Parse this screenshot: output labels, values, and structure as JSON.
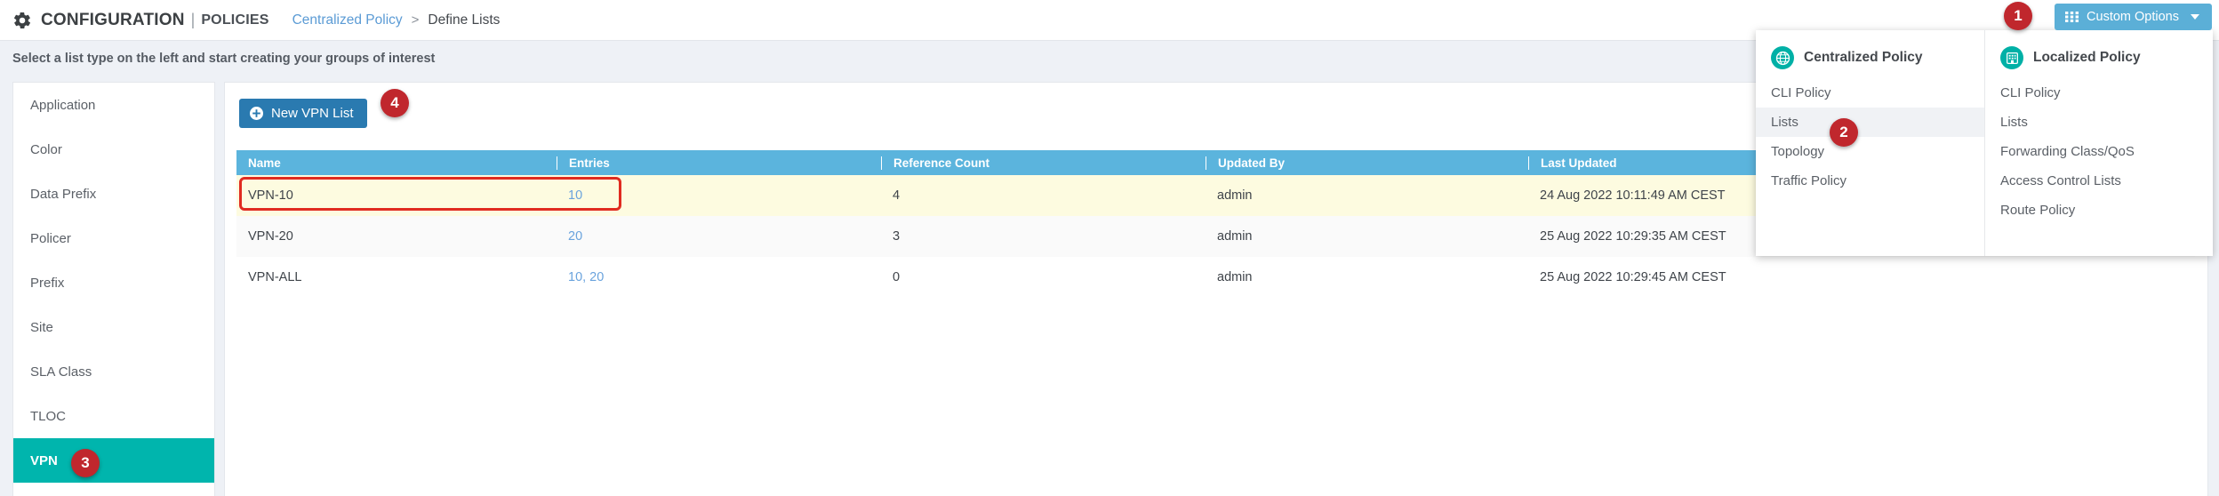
{
  "header": {
    "gear_icon": "gear-icon",
    "app_title": "CONFIGURATION",
    "title_separator": "|",
    "section": "POLICIES",
    "breadcrumb": {
      "link": "Centralized Policy",
      "separator": ">",
      "current": "Define Lists"
    },
    "custom_options": {
      "label": "Custom Options",
      "grid_icon": "grid-icon",
      "caret_icon": "chevron-down-icon"
    }
  },
  "subheader": {
    "text": "Select a list type on the left and start creating your groups of interest"
  },
  "sidebar": {
    "items": [
      {
        "label": "Application",
        "active": false
      },
      {
        "label": "Color",
        "active": false
      },
      {
        "label": "Data Prefix",
        "active": false
      },
      {
        "label": "Policer",
        "active": false
      },
      {
        "label": "Prefix",
        "active": false
      },
      {
        "label": "Site",
        "active": false
      },
      {
        "label": "SLA Class",
        "active": false
      },
      {
        "label": "TLOC",
        "active": false
      },
      {
        "label": "VPN",
        "active": true
      }
    ]
  },
  "main": {
    "new_button": {
      "label": "New VPN List",
      "icon": "plus-circle-icon"
    },
    "table": {
      "columns": [
        "Name",
        "Entries",
        "Reference Count",
        "Updated By",
        "Last Updated",
        ""
      ],
      "rows": [
        {
          "name": "VPN-10",
          "entries": "10",
          "reference_count": "4",
          "updated_by": "admin",
          "last_updated": "24 Aug 2022 10:11:49 AM CEST",
          "highlighted": true
        },
        {
          "name": "VPN-20",
          "entries": "20",
          "reference_count": "3",
          "updated_by": "admin",
          "last_updated": "25 Aug 2022 10:29:35 AM CEST",
          "highlighted": false
        },
        {
          "name": "VPN-ALL",
          "entries": "10, 20",
          "reference_count": "0",
          "updated_by": "admin",
          "last_updated": "25 Aug 2022 10:29:45 AM CEST",
          "highlighted": false
        }
      ],
      "row_actions": [
        "edit-pencil-icon",
        "copy-icon",
        "delete-trash-icon"
      ]
    }
  },
  "dropdown": {
    "left": {
      "icon": "globe-icon",
      "title": "Centralized Policy",
      "items": [
        {
          "label": "CLI Policy",
          "highlighted": false
        },
        {
          "label": "Lists",
          "highlighted": true
        },
        {
          "label": "Topology",
          "highlighted": false
        },
        {
          "label": "Traffic Policy",
          "highlighted": false
        }
      ]
    },
    "right": {
      "icon": "building-icon",
      "title": "Localized Policy",
      "items": [
        {
          "label": "CLI Policy",
          "highlighted": false
        },
        {
          "label": "Lists",
          "highlighted": false
        },
        {
          "label": "Forwarding Class/QoS",
          "highlighted": false
        },
        {
          "label": "Access Control Lists",
          "highlighted": false
        },
        {
          "label": "Route Policy",
          "highlighted": false
        }
      ]
    }
  },
  "callouts": [
    {
      "number": "1"
    },
    {
      "number": "2"
    },
    {
      "number": "3"
    },
    {
      "number": "4"
    }
  ],
  "colors": {
    "accent_blue": "#5bafd7",
    "header_blue": "#5bb4dd",
    "button_blue": "#2a7ab0",
    "teal": "#00b5ad",
    "callout_red": "#c0272d",
    "highlight_row": "#fdfbe0",
    "link": "#6aa3dd"
  }
}
